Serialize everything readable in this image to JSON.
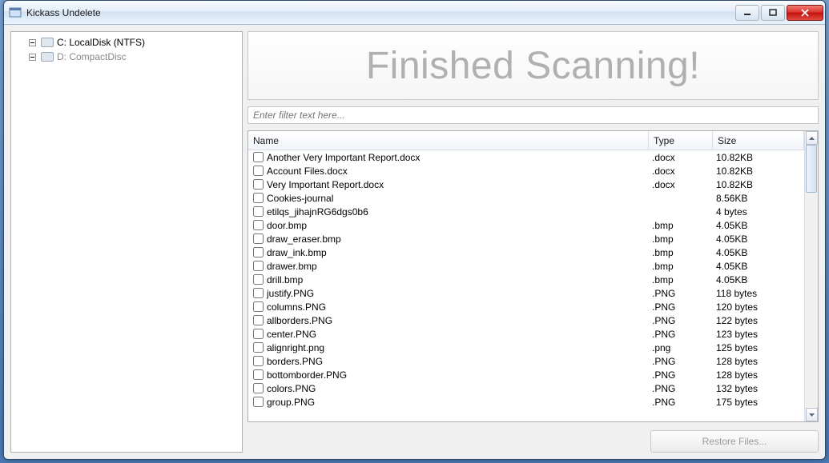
{
  "window": {
    "title": "Kickass Undelete"
  },
  "sidebar": {
    "drives": [
      {
        "label": "C: LocalDisk (NTFS)",
        "active": true
      },
      {
        "label": "D: CompactDisc",
        "active": false
      }
    ]
  },
  "banner": {
    "text": "Finished Scanning!"
  },
  "filter": {
    "placeholder": "Enter filter text here..."
  },
  "columns": {
    "name": "Name",
    "type": "Type",
    "size": "Size"
  },
  "files": [
    {
      "name": "Another Very Important Report.docx",
      "type": ".docx",
      "size": "10.82KB"
    },
    {
      "name": "Account Files.docx",
      "type": ".docx",
      "size": "10.82KB"
    },
    {
      "name": "Very Important Report.docx",
      "type": ".docx",
      "size": "10.82KB"
    },
    {
      "name": "Cookies-journal",
      "type": "",
      "size": "8.56KB"
    },
    {
      "name": "etilqs_jihajnRG6dgs0b6",
      "type": "",
      "size": "4 bytes"
    },
    {
      "name": "door.bmp",
      "type": ".bmp",
      "size": "4.05KB"
    },
    {
      "name": "draw_eraser.bmp",
      "type": ".bmp",
      "size": "4.05KB"
    },
    {
      "name": "draw_ink.bmp",
      "type": ".bmp",
      "size": "4.05KB"
    },
    {
      "name": "drawer.bmp",
      "type": ".bmp",
      "size": "4.05KB"
    },
    {
      "name": "drill.bmp",
      "type": ".bmp",
      "size": "4.05KB"
    },
    {
      "name": "justify.PNG",
      "type": ".PNG",
      "size": "118 bytes"
    },
    {
      "name": "columns.PNG",
      "type": ".PNG",
      "size": "120 bytes"
    },
    {
      "name": "allborders.PNG",
      "type": ".PNG",
      "size": "122 bytes"
    },
    {
      "name": "center.PNG",
      "type": ".PNG",
      "size": "123 bytes"
    },
    {
      "name": "alignright.png",
      "type": ".png",
      "size": "125 bytes"
    },
    {
      "name": "borders.PNG",
      "type": ".PNG",
      "size": "128 bytes"
    },
    {
      "name": "bottomborder.PNG",
      "type": ".PNG",
      "size": "128 bytes"
    },
    {
      "name": "colors.PNG",
      "type": ".PNG",
      "size": "132 bytes"
    },
    {
      "name": "group.PNG",
      "type": ".PNG",
      "size": "175 bytes"
    }
  ],
  "footer": {
    "restore_label": "Restore Files..."
  }
}
